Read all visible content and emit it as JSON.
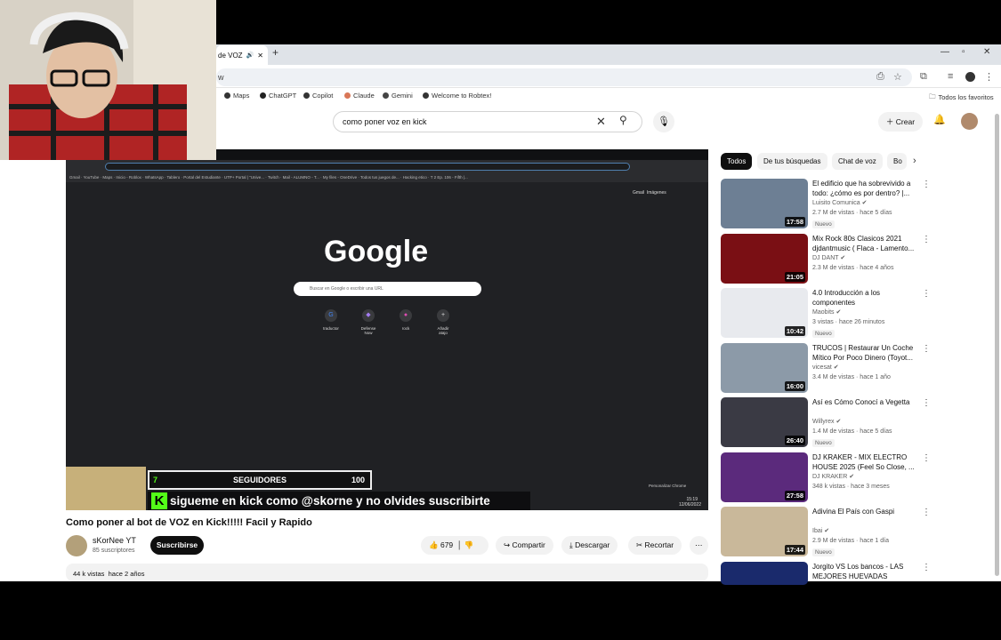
{
  "browser": {
    "tab_title": "de VOZ",
    "address": "w",
    "bookmarks": [
      "Maps",
      "ChatGPT",
      "Copilot",
      "Claude",
      "Gemini",
      "Welcome to Robtex!"
    ],
    "all_bookmarks": "Todos los favoritos"
  },
  "header": {
    "search_value": "como poner voz en kick",
    "create_label": "Crear"
  },
  "video": {
    "inner_bookmarks": "Gmail · YouTube · Maps · Inicio - Roblox · WhatsApp · Tablero · Portal del Estudiante · UTP+ Portal | \"Unive... · Twitch · Mail - ALUMNO - T... · My files - OneDrive · Todos tus juegos de... · Hacking etico · T 2 Ep. 106 - Fifth |...",
    "google_logo": "Google",
    "google_search_placeholder": "Buscar en Google o escribir una URL",
    "gmail": "Gmail",
    "images": "Imágenes",
    "shortcuts": [
      "traductor",
      "Defense Now",
      "rock",
      "Añadir atajo"
    ],
    "overlay_count": "7",
    "overlay_label": "SEGUIDORES",
    "overlay_value": "100",
    "kick_message": "sigueme en kick como @skorne y no olvides suscribirte",
    "customize": "Personalizar Chrome",
    "clock_time": "15:19",
    "clock_date": "12/06/2022",
    "title": "Como poner al bot de VOZ en Kick!!!!! Facil y Rapido",
    "channel": "sKorNee YT",
    "subscribers": "85 suscriptores",
    "subscribe_label": "Suscribirse",
    "likes": "679",
    "share": "Compartir",
    "download": "Descargar",
    "clip": "Recortar",
    "views": "44 k vistas",
    "age": "hace 2 años"
  },
  "sidebar": {
    "chips": [
      "Todos",
      "De tus búsquedas",
      "Chat de voz",
      "Bo"
    ],
    "recommendations": [
      {
        "title": "El edificio que ha sobrevivido a todo: ¿cómo es por dentro? |...",
        "channel": "Luisito Comunica",
        "meta": "2.7 M de vistas · hace 5 días",
        "badge": "Nuevo",
        "duration": "17:58",
        "color": "#6d7f94"
      },
      {
        "title": "Mix Rock 80s Clasicos 2021 djdantmusic ( Flaca - Lamento...",
        "channel": "DJ DANT",
        "meta": "2.3 M de vistas · hace 4 años",
        "badge": "",
        "duration": "21:05",
        "color": "#7a0f14"
      },
      {
        "title": "4.0 Introducción a los componentes",
        "channel": "Maobits",
        "meta": "3 vistas · hace 26 minutos",
        "badge": "Nuevo",
        "duration": "10:42",
        "color": "#e8eaee"
      },
      {
        "title": "TRUCOS | Restaurar Un Coche Mítico Por Poco Dinero (Toyot...",
        "channel": "vicesat",
        "meta": "3.4 M de vistas · hace 1 año",
        "badge": "",
        "duration": "16:00",
        "color": "#8c9aa8"
      },
      {
        "title": "Así es Cómo Conocí a Vegetta",
        "channel": "Willyrex",
        "meta": "1.4 M de vistas · hace 5 días",
        "badge": "Nuevo",
        "duration": "26:40",
        "color": "#3a3a44"
      },
      {
        "title": "DJ KRAKER - MIX ELECTRO HOUSE 2025 (Feel So Close, ...",
        "channel": "DJ KRAKER",
        "meta": "348 k vistas · hace 3 meses",
        "badge": "",
        "duration": "27:58",
        "color": "#5b2a7c"
      },
      {
        "title": "Adivina El País con Gaspi",
        "channel": "Ibai",
        "meta": "2.9 M de vistas · hace 1 día",
        "badge": "Nuevo",
        "duration": "17:44",
        "color": "#c9b89a"
      },
      {
        "title": "Jorgito VS Los bancos - LAS MEJORES HUEVADAS",
        "channel": "",
        "meta": "",
        "badge": "",
        "duration": "",
        "color": "#1a2a6c"
      }
    ]
  }
}
